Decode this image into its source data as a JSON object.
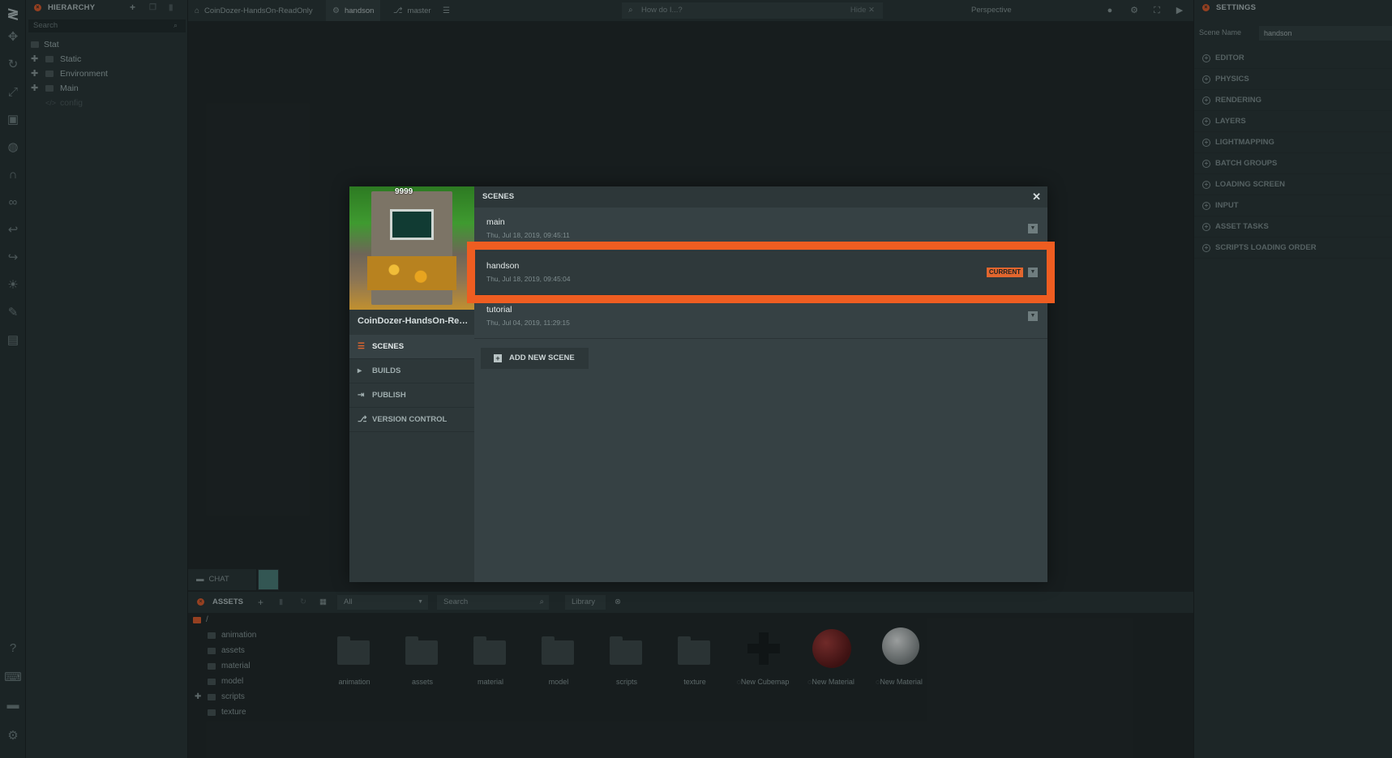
{
  "hierarchy": {
    "title": "HIERARCHY",
    "search_placeholder": "Search",
    "tree": [
      {
        "label": "Stat",
        "expandable": false
      },
      {
        "label": "Static",
        "expandable": true
      },
      {
        "label": "Environment",
        "expandable": true
      },
      {
        "label": "Main",
        "expandable": true
      },
      {
        "label": "config",
        "expandable": false
      }
    ]
  },
  "topbar": {
    "project_tab": "CoinDozer-HandsOn-ReadOnly",
    "scene_tab": "handson",
    "branch_tab": "master",
    "search_placeholder": "How do I...?",
    "hide_label": "Hide",
    "camera_label": "Perspective"
  },
  "settings": {
    "title": "SETTINGS",
    "scene_name_label": "Scene Name",
    "scene_name_value": "handson",
    "sections": [
      "EDITOR",
      "PHYSICS",
      "RENDERING",
      "LAYERS",
      "LIGHTMAPPING",
      "BATCH GROUPS",
      "LOADING SCREEN",
      "INPUT",
      "ASSET TASKS",
      "SCRIPTS LOADING ORDER"
    ]
  },
  "chat": {
    "label": "CHAT"
  },
  "assets": {
    "title": "ASSETS",
    "filter_value": "All",
    "search_placeholder": "Search",
    "library_label": "Library",
    "root": "/",
    "folders": [
      "animation",
      "assets",
      "material",
      "model",
      "scripts",
      "texture"
    ],
    "grid": [
      {
        "label": "animation",
        "kind": "folder"
      },
      {
        "label": "assets",
        "kind": "folder"
      },
      {
        "label": "material",
        "kind": "folder"
      },
      {
        "label": "model",
        "kind": "folder"
      },
      {
        "label": "scripts",
        "kind": "folder"
      },
      {
        "label": "texture",
        "kind": "folder"
      },
      {
        "label": "New Cubemap",
        "kind": "cubemap"
      },
      {
        "label": "New Material",
        "kind": "material-red"
      },
      {
        "label": "New Material",
        "kind": "material-grey"
      }
    ]
  },
  "modal": {
    "title": "SCENES",
    "project_name": "CoinDozer-HandsOn-ReadOnly",
    "score": "9999",
    "nav": [
      {
        "label": "SCENES",
        "icon": "list-icon",
        "active": true
      },
      {
        "label": "BUILDS",
        "icon": "play-icon",
        "active": false
      },
      {
        "label": "PUBLISH",
        "icon": "publish-icon",
        "active": false
      },
      {
        "label": "VERSION CONTROL",
        "icon": "branch-icon",
        "active": false
      }
    ],
    "scenes": [
      {
        "name": "main",
        "date": "Thu, Jul 18, 2019, 09:45:11",
        "current": false
      },
      {
        "name": "handson",
        "date": "Thu, Jul 18, 2019, 09:45:04",
        "current": true
      },
      {
        "name": "tutorial",
        "date": "Thu, Jul 04, 2019, 11:29:15",
        "current": false
      }
    ],
    "current_badge": "CURRENT",
    "add_button": "ADD NEW SCENE"
  },
  "colors": {
    "accent": "#e2662e",
    "highlight": "#ef5d21"
  }
}
